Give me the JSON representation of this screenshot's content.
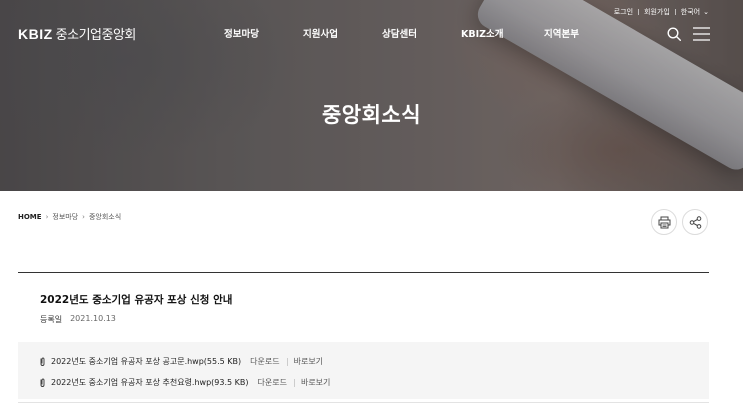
{
  "header": {
    "logo_mark": "KBIZ",
    "logo_text": "중소기업중앙회",
    "util": {
      "login": "로그인",
      "join": "회원가입",
      "language": "한국어"
    },
    "nav": [
      "정보마당",
      "지원사업",
      "상담센터",
      "KBIZ소개",
      "지역본부"
    ],
    "icons": {
      "search": "search-icon",
      "menu": "menu-icon"
    }
  },
  "hero": {
    "title": "중앙회소식"
  },
  "breadcrumb": {
    "home": "HOME",
    "level1": "정보마당",
    "level2": "중앙회소식"
  },
  "tools": {
    "print": "print-icon",
    "share": "share-icon"
  },
  "post": {
    "title": "2022년도 중소기업 유공자 포상 신청 안내",
    "date_label": "등록일",
    "date": "2021.10.13"
  },
  "attachments": [
    {
      "name": "2022년도 중소기업 유공자 포상 공고문.hwp(55.5 KB)",
      "download": "다운로드",
      "view": "바로보기"
    },
    {
      "name": "2022년도 중소기업 유공자 포상 추천요령.hwp(93.5 KB)",
      "download": "다운로드",
      "view": "바로보기"
    }
  ]
}
